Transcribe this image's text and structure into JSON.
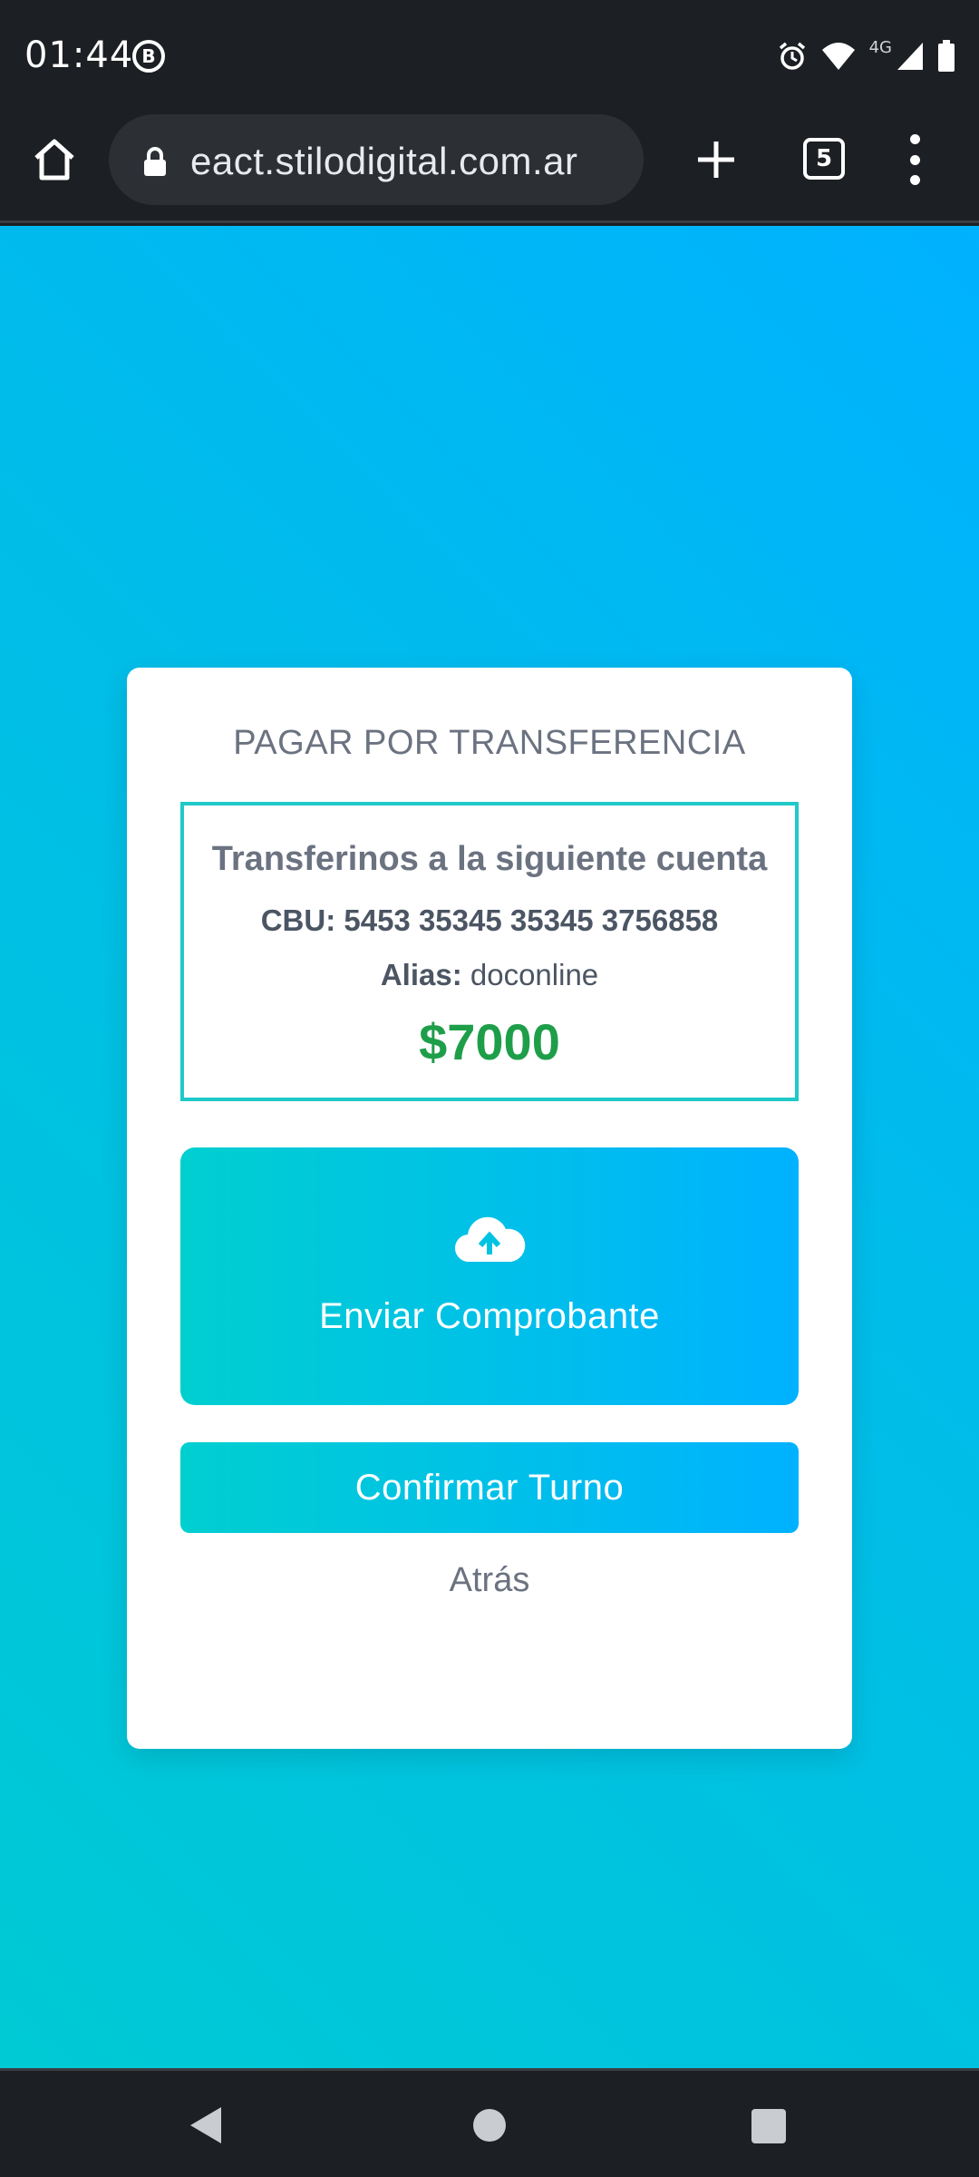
{
  "status_bar": {
    "time": "01:44",
    "notification_badge": "B",
    "network_label": "4G",
    "icons": [
      "alarm-icon",
      "wifi-icon",
      "signal-icon",
      "battery-icon"
    ]
  },
  "browser": {
    "url": "eact.stilodigital.com.ar",
    "tab_count": "5",
    "icons": [
      "home-icon",
      "lock-icon",
      "new-tab-icon",
      "tabs-icon",
      "menu-icon"
    ]
  },
  "card": {
    "title": "PAGAR POR TRANSFERENCIA",
    "account": {
      "heading": "Transferinos a la siguiente cuenta",
      "cbu_label": "CBU:",
      "cbu_value": "5453 35345 35345 3756858",
      "alias_label": "Alias:",
      "alias_value": "doconline",
      "amount": "$7000"
    },
    "upload_label": "Enviar Comprobante",
    "confirm_label": "Confirmar Turno",
    "back_label": "Atrás"
  },
  "colors": {
    "gradient_start": "#00cfd0",
    "gradient_end": "#00b2ff",
    "amount_green": "#1f9e4a",
    "box_border": "#20c9c9",
    "text_gray": "#6b7280"
  }
}
